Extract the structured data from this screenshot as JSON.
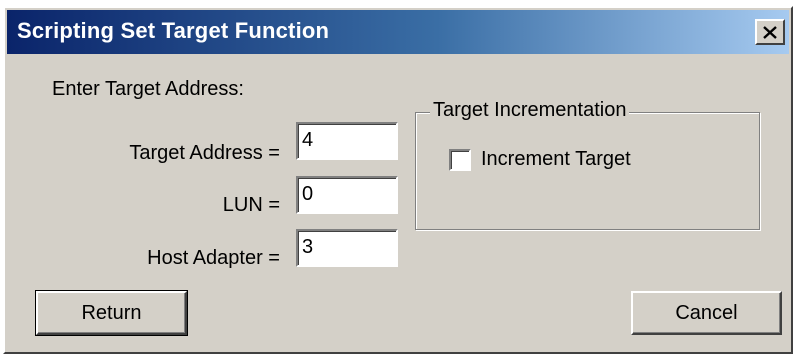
{
  "window": {
    "title": "Scripting Set Target Function",
    "close_icon": "close-icon"
  },
  "form": {
    "prompt": "Enter Target Address:",
    "target_address_label": "Target Address =",
    "target_address_value": "4",
    "lun_label": "LUN =",
    "lun_value": "0",
    "host_adapter_label": "Host Adapter =",
    "host_adapter_value": "3"
  },
  "incrementation": {
    "group_title": "Target Incrementation",
    "checkbox_label": "Increment Target",
    "checked": false
  },
  "buttons": {
    "return_label": "Return",
    "cancel_label": "Cancel"
  },
  "colors": {
    "title_gradient_start": "#0a246a",
    "title_gradient_end": "#a6caf0",
    "dialog_face": "#d4d0c8"
  }
}
